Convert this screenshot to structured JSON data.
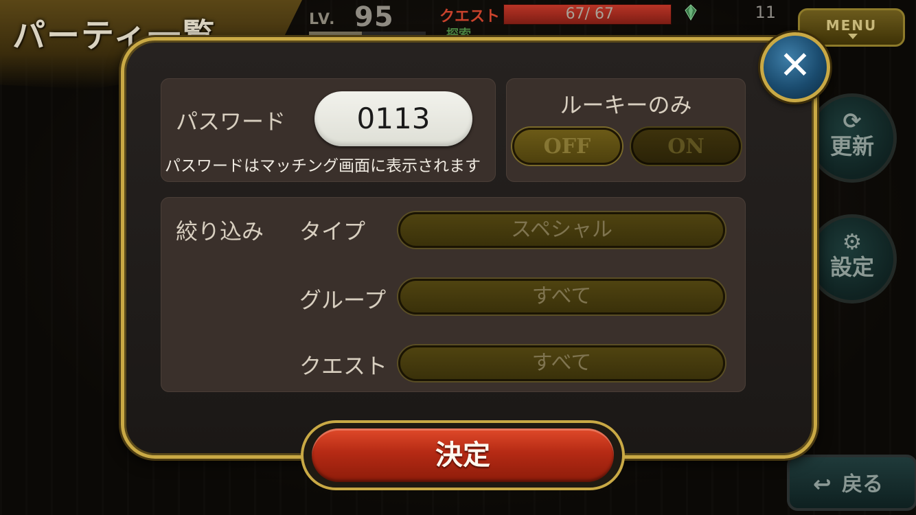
{
  "header": {
    "screen_title": "パーティ一覧",
    "level_label": "LV.",
    "level_value": "95",
    "quest_label": "クエスト",
    "quest_stamina": "67/ 67",
    "explore_label": "探索",
    "gem_count": "11",
    "menu_label": "MENU"
  },
  "side_buttons": {
    "refresh_label": "更新",
    "settings_label": "設定",
    "back_label": "戻る"
  },
  "dialog": {
    "password_label": "パスワード",
    "password_value": "0113",
    "password_note": "パスワードはマッチング画面に表示されます",
    "rookie_label": "ルーキーのみ",
    "rookie_off_label": "OFF",
    "rookie_on_label": "ON",
    "filter_label": "絞り込み",
    "filters": [
      {
        "label": "タイプ",
        "value": "スペシャル"
      },
      {
        "label": "グループ",
        "value": "すべて"
      },
      {
        "label": "クエスト",
        "value": "すべて"
      }
    ],
    "confirm_label": "決定",
    "close_symbol": "✕"
  },
  "colors": {
    "gold_border": "#c9a945",
    "confirm_red": "#b52a14",
    "close_blue": "#1a4b6e"
  }
}
